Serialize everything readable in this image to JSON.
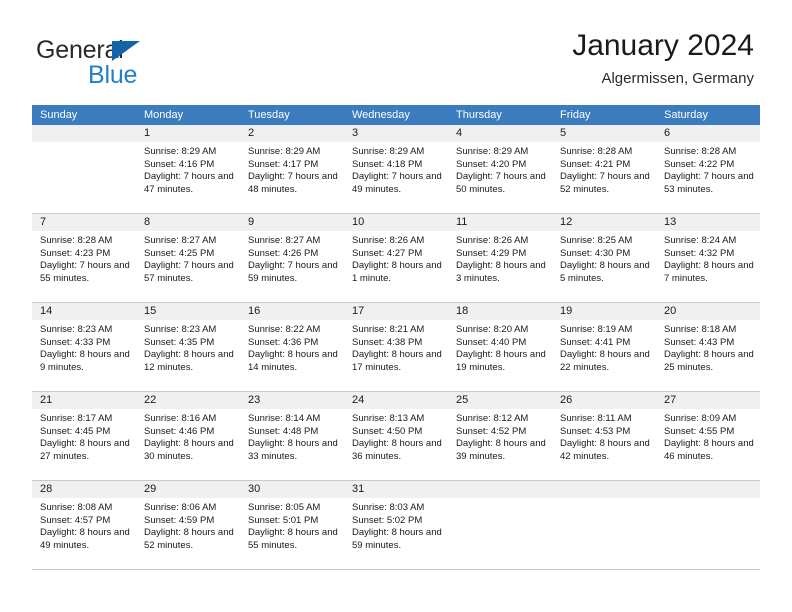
{
  "brand": {
    "name_part1": "General",
    "name_part2": "Blue",
    "accent_color": "#2280c8",
    "triangle_color": "#1263a8"
  },
  "header": {
    "title": "January 2024",
    "subtitle": "Algermissen, Germany"
  },
  "calendar": {
    "header_bg": "#3a7cbe",
    "weekdays": [
      "Sunday",
      "Monday",
      "Tuesday",
      "Wednesday",
      "Thursday",
      "Friday",
      "Saturday"
    ],
    "weeks": [
      [
        {
          "day": "",
          "sunrise": "",
          "sunset": "",
          "daylight": ""
        },
        {
          "day": "1",
          "sunrise": "Sunrise: 8:29 AM",
          "sunset": "Sunset: 4:16 PM",
          "daylight": "Daylight: 7 hours and 47 minutes."
        },
        {
          "day": "2",
          "sunrise": "Sunrise: 8:29 AM",
          "sunset": "Sunset: 4:17 PM",
          "daylight": "Daylight: 7 hours and 48 minutes."
        },
        {
          "day": "3",
          "sunrise": "Sunrise: 8:29 AM",
          "sunset": "Sunset: 4:18 PM",
          "daylight": "Daylight: 7 hours and 49 minutes."
        },
        {
          "day": "4",
          "sunrise": "Sunrise: 8:29 AM",
          "sunset": "Sunset: 4:20 PM",
          "daylight": "Daylight: 7 hours and 50 minutes."
        },
        {
          "day": "5",
          "sunrise": "Sunrise: 8:28 AM",
          "sunset": "Sunset: 4:21 PM",
          "daylight": "Daylight: 7 hours and 52 minutes."
        },
        {
          "day": "6",
          "sunrise": "Sunrise: 8:28 AM",
          "sunset": "Sunset: 4:22 PM",
          "daylight": "Daylight: 7 hours and 53 minutes."
        }
      ],
      [
        {
          "day": "7",
          "sunrise": "Sunrise: 8:28 AM",
          "sunset": "Sunset: 4:23 PM",
          "daylight": "Daylight: 7 hours and 55 minutes."
        },
        {
          "day": "8",
          "sunrise": "Sunrise: 8:27 AM",
          "sunset": "Sunset: 4:25 PM",
          "daylight": "Daylight: 7 hours and 57 minutes."
        },
        {
          "day": "9",
          "sunrise": "Sunrise: 8:27 AM",
          "sunset": "Sunset: 4:26 PM",
          "daylight": "Daylight: 7 hours and 59 minutes."
        },
        {
          "day": "10",
          "sunrise": "Sunrise: 8:26 AM",
          "sunset": "Sunset: 4:27 PM",
          "daylight": "Daylight: 8 hours and 1 minute."
        },
        {
          "day": "11",
          "sunrise": "Sunrise: 8:26 AM",
          "sunset": "Sunset: 4:29 PM",
          "daylight": "Daylight: 8 hours and 3 minutes."
        },
        {
          "day": "12",
          "sunrise": "Sunrise: 8:25 AM",
          "sunset": "Sunset: 4:30 PM",
          "daylight": "Daylight: 8 hours and 5 minutes."
        },
        {
          "day": "13",
          "sunrise": "Sunrise: 8:24 AM",
          "sunset": "Sunset: 4:32 PM",
          "daylight": "Daylight: 8 hours and 7 minutes."
        }
      ],
      [
        {
          "day": "14",
          "sunrise": "Sunrise: 8:23 AM",
          "sunset": "Sunset: 4:33 PM",
          "daylight": "Daylight: 8 hours and 9 minutes."
        },
        {
          "day": "15",
          "sunrise": "Sunrise: 8:23 AM",
          "sunset": "Sunset: 4:35 PM",
          "daylight": "Daylight: 8 hours and 12 minutes."
        },
        {
          "day": "16",
          "sunrise": "Sunrise: 8:22 AM",
          "sunset": "Sunset: 4:36 PM",
          "daylight": "Daylight: 8 hours and 14 minutes."
        },
        {
          "day": "17",
          "sunrise": "Sunrise: 8:21 AM",
          "sunset": "Sunset: 4:38 PM",
          "daylight": "Daylight: 8 hours and 17 minutes."
        },
        {
          "day": "18",
          "sunrise": "Sunrise: 8:20 AM",
          "sunset": "Sunset: 4:40 PM",
          "daylight": "Daylight: 8 hours and 19 minutes."
        },
        {
          "day": "19",
          "sunrise": "Sunrise: 8:19 AM",
          "sunset": "Sunset: 4:41 PM",
          "daylight": "Daylight: 8 hours and 22 minutes."
        },
        {
          "day": "20",
          "sunrise": "Sunrise: 8:18 AM",
          "sunset": "Sunset: 4:43 PM",
          "daylight": "Daylight: 8 hours and 25 minutes."
        }
      ],
      [
        {
          "day": "21",
          "sunrise": "Sunrise: 8:17 AM",
          "sunset": "Sunset: 4:45 PM",
          "daylight": "Daylight: 8 hours and 27 minutes."
        },
        {
          "day": "22",
          "sunrise": "Sunrise: 8:16 AM",
          "sunset": "Sunset: 4:46 PM",
          "daylight": "Daylight: 8 hours and 30 minutes."
        },
        {
          "day": "23",
          "sunrise": "Sunrise: 8:14 AM",
          "sunset": "Sunset: 4:48 PM",
          "daylight": "Daylight: 8 hours and 33 minutes."
        },
        {
          "day": "24",
          "sunrise": "Sunrise: 8:13 AM",
          "sunset": "Sunset: 4:50 PM",
          "daylight": "Daylight: 8 hours and 36 minutes."
        },
        {
          "day": "25",
          "sunrise": "Sunrise: 8:12 AM",
          "sunset": "Sunset: 4:52 PM",
          "daylight": "Daylight: 8 hours and 39 minutes."
        },
        {
          "day": "26",
          "sunrise": "Sunrise: 8:11 AM",
          "sunset": "Sunset: 4:53 PM",
          "daylight": "Daylight: 8 hours and 42 minutes."
        },
        {
          "day": "27",
          "sunrise": "Sunrise: 8:09 AM",
          "sunset": "Sunset: 4:55 PM",
          "daylight": "Daylight: 8 hours and 46 minutes."
        }
      ],
      [
        {
          "day": "28",
          "sunrise": "Sunrise: 8:08 AM",
          "sunset": "Sunset: 4:57 PM",
          "daylight": "Daylight: 8 hours and 49 minutes."
        },
        {
          "day": "29",
          "sunrise": "Sunrise: 8:06 AM",
          "sunset": "Sunset: 4:59 PM",
          "daylight": "Daylight: 8 hours and 52 minutes."
        },
        {
          "day": "30",
          "sunrise": "Sunrise: 8:05 AM",
          "sunset": "Sunset: 5:01 PM",
          "daylight": "Daylight: 8 hours and 55 minutes."
        },
        {
          "day": "31",
          "sunrise": "Sunrise: 8:03 AM",
          "sunset": "Sunset: 5:02 PM",
          "daylight": "Daylight: 8 hours and 59 minutes."
        },
        {
          "day": "",
          "sunrise": "",
          "sunset": "",
          "daylight": ""
        },
        {
          "day": "",
          "sunrise": "",
          "sunset": "",
          "daylight": ""
        },
        {
          "day": "",
          "sunrise": "",
          "sunset": "",
          "daylight": ""
        }
      ]
    ]
  }
}
